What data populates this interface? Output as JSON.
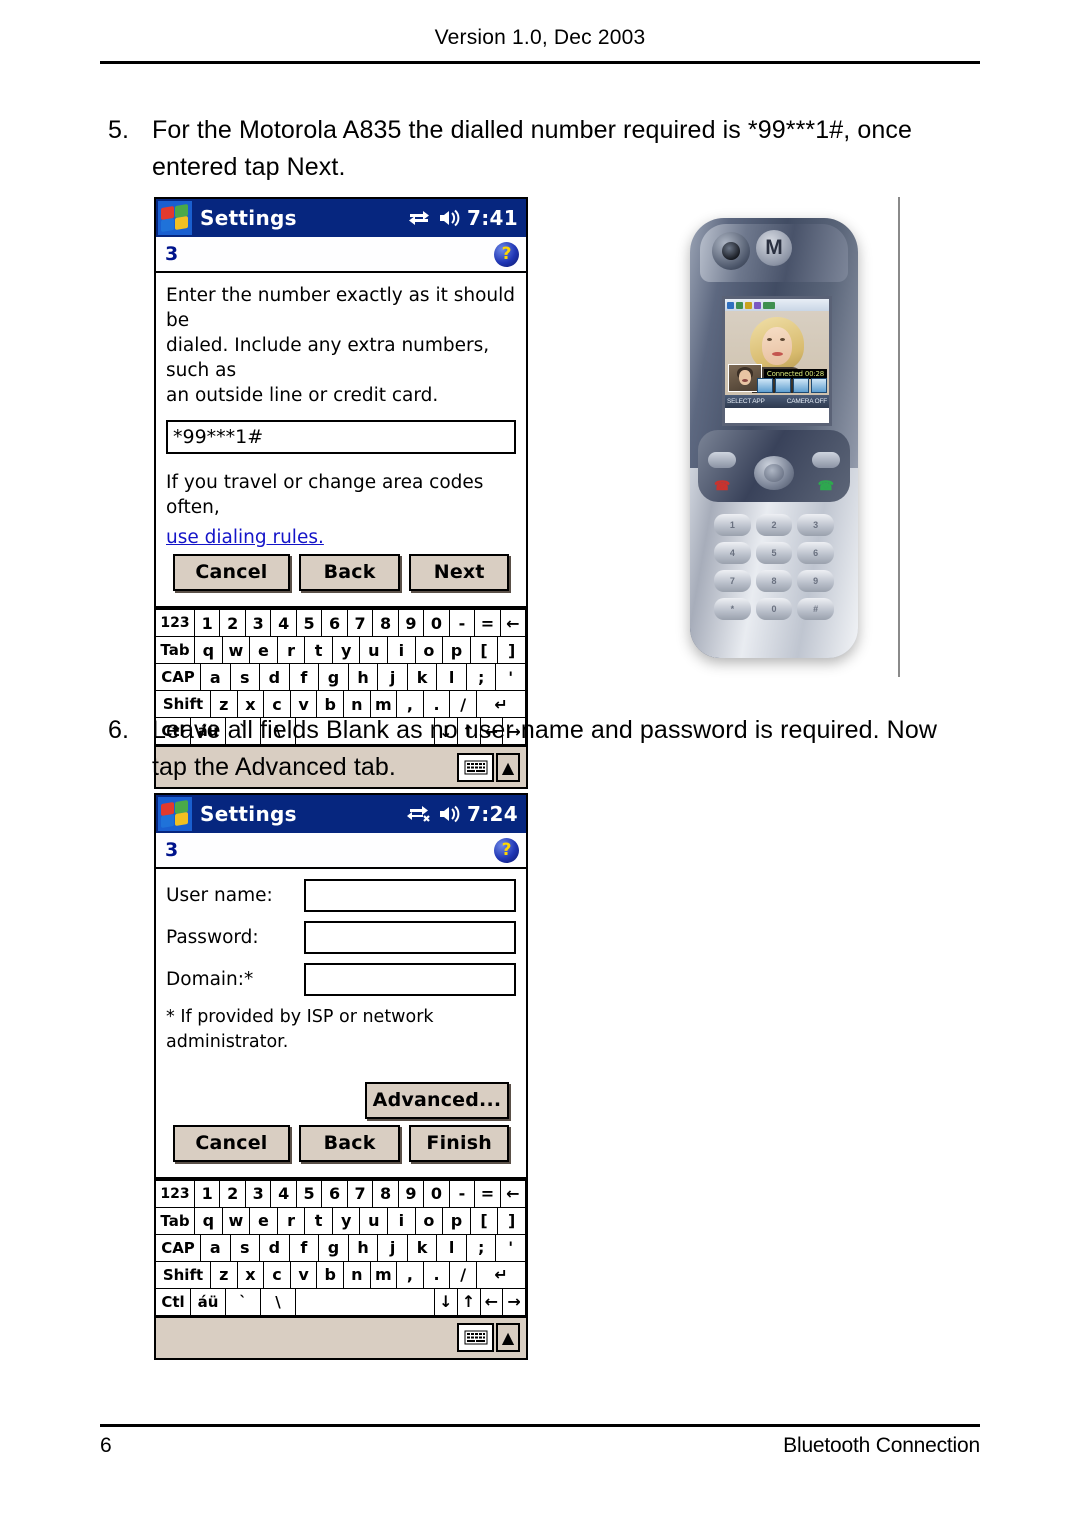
{
  "page": {
    "header": "Version 1.0, Dec 2003",
    "footer_page_number": "6",
    "footer_title": "Bluetooth Connection"
  },
  "steps": [
    {
      "number": "5.",
      "text": "For the Motorola A835 the dialled number required is *99***1#, once entered tap Next."
    },
    {
      "number": "6.",
      "text": "Leave all fields Blank as no user name and password is required. Now tap the Advanced tab."
    }
  ],
  "screenshot_one": {
    "titlebar": {
      "app_title": "Settings",
      "clock": "7:41",
      "connectivity_icon": "connection-arrows-icon",
      "speaker_icon": "speaker-icon"
    },
    "subbar": {
      "page_index": "3",
      "help_icon": "?"
    },
    "instruction": "Enter the number exactly as it should be\ndialed.  Include any extra numbers, such as\nan outside line or credit card.",
    "phone_number_value": "*99***1#",
    "dialing_hint": "If you travel or change area codes often,",
    "dialing_link": "use dialing rules.",
    "buttons": {
      "cancel": "Cancel",
      "back": "Back",
      "next": "Next"
    }
  },
  "screenshot_two": {
    "titlebar": {
      "app_title": "Settings",
      "clock": "7:24",
      "connectivity_icon": "connection-disconnected-icon",
      "speaker_icon": "speaker-icon"
    },
    "subbar": {
      "page_index": "3",
      "help_icon": "?"
    },
    "fields": [
      {
        "label": "User name:",
        "value": ""
      },
      {
        "label": "Password:",
        "value": ""
      },
      {
        "label": "Domain:*",
        "value": ""
      }
    ],
    "note": "* If provided by ISP or network administrator.",
    "buttons": {
      "advanced": "Advanced...",
      "cancel": "Cancel",
      "back": "Back",
      "finish": "Finish"
    }
  },
  "keyboard": {
    "row1": [
      "123",
      "1",
      "2",
      "3",
      "4",
      "5",
      "6",
      "7",
      "8",
      "9",
      "0",
      "-",
      "=",
      "←"
    ],
    "row2": [
      "Tab",
      "q",
      "w",
      "e",
      "r",
      "t",
      "y",
      "u",
      "i",
      "o",
      "p",
      "[",
      "]"
    ],
    "row3": [
      "CAP",
      "a",
      "s",
      "d",
      "f",
      "g",
      "h",
      "j",
      "k",
      "l",
      ";",
      "'"
    ],
    "row4": [
      "Shift",
      "z",
      "x",
      "c",
      "v",
      "b",
      "n",
      "m",
      ",",
      ".",
      "/",
      "↵"
    ],
    "row5": [
      "Ctl",
      "áü",
      "`",
      "\\",
      "",
      "↓",
      "↑",
      "←",
      "→"
    ],
    "taskbar": {
      "keyboard_icon": "keyboard-icon",
      "up_arrow": "▲"
    }
  },
  "phone_photo": {
    "device": "Motorola A835",
    "screen": {
      "call_status": "Connected 00:28",
      "softkeys_left": "SELECT APP",
      "softkeys_right": "CAMERA OFF"
    },
    "keypad": [
      "1",
      "2",
      "3",
      "4",
      "5",
      "6",
      "7",
      "8",
      "9",
      "*",
      "0",
      "#"
    ]
  },
  "colors": {
    "titlebar_blue": "#06267f",
    "button_face": "#d9cec2",
    "link_blue": "#1414c8",
    "help_yellow": "#ffd700"
  }
}
